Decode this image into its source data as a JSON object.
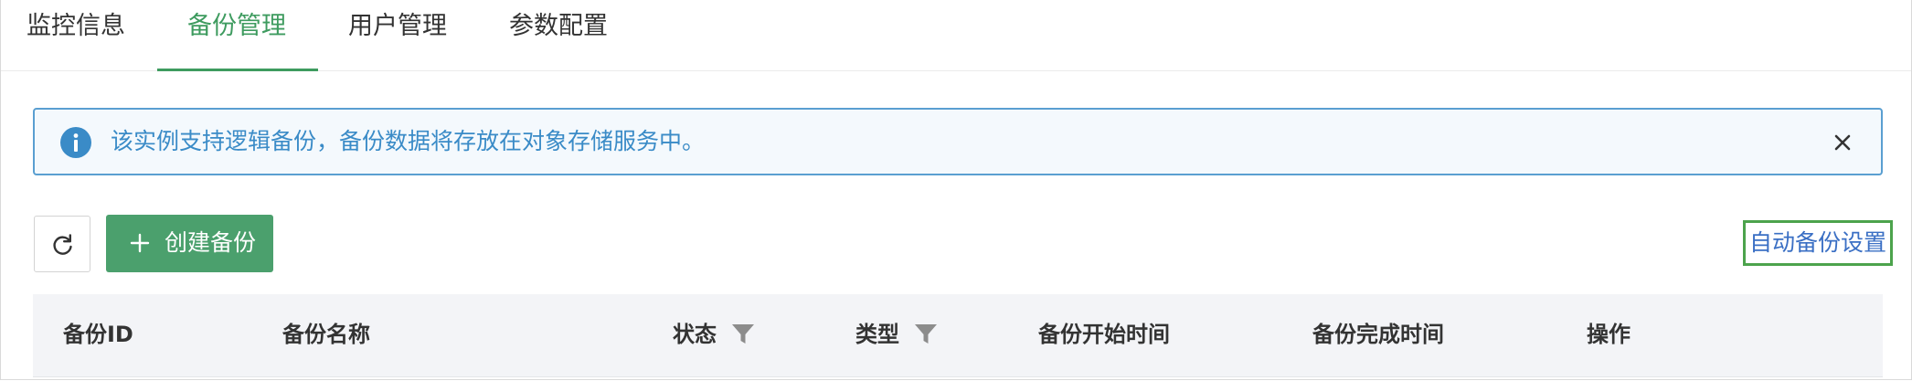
{
  "tabs": [
    {
      "label": "监控信息",
      "active": false
    },
    {
      "label": "备份管理",
      "active": true
    },
    {
      "label": "用户管理",
      "active": false
    },
    {
      "label": "参数配置",
      "active": false
    }
  ],
  "alert": {
    "icon": "info-icon",
    "text": "该实例支持逻辑备份，备份数据将存放在对象存储服务中。",
    "close_icon": "close-icon"
  },
  "toolbar": {
    "refresh_icon": "refresh-icon",
    "create_label": "创建备份",
    "create_icon": "plus-icon",
    "auto_backup_label": "自动备份设置"
  },
  "table": {
    "columns": [
      {
        "label": "备份ID",
        "filter": false
      },
      {
        "label": "备份名称",
        "filter": false
      },
      {
        "label": "状态",
        "filter": true
      },
      {
        "label": "类型",
        "filter": true
      },
      {
        "label": "备份开始时间",
        "filter": false
      },
      {
        "label": "备份完成时间",
        "filter": false
      },
      {
        "label": "操作",
        "filter": false
      }
    ]
  },
  "colors": {
    "accent": "#3e9b5f",
    "primary_button": "#4ba06d",
    "info": "#3a8bc7",
    "link": "#3a6fc4"
  }
}
